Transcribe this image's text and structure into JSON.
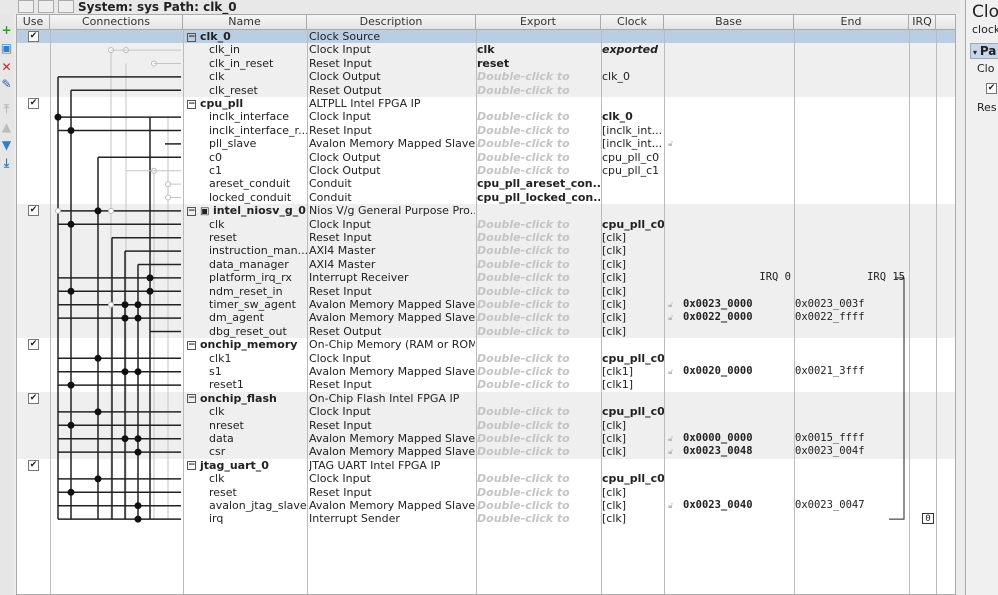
{
  "topbar": {
    "label": "System: sys   Path: clk_0"
  },
  "columns": {
    "use": "Use",
    "connections": "Connections",
    "name": "Name",
    "description": "Description",
    "export": "Export",
    "clock": "Clock",
    "base": "Base",
    "end": "End",
    "irq": "IRQ"
  },
  "toolbar": [
    {
      "icon": "add-icon",
      "glyph": "+",
      "color": "#2a9d2a"
    },
    {
      "icon": "add-connection-icon",
      "glyph": "▣",
      "color": "#2f7fc9"
    },
    {
      "icon": "remove-icon",
      "glyph": "✕",
      "color": "#d32020"
    },
    {
      "icon": "edit-icon",
      "glyph": "✎",
      "color": "#2f5fb0"
    },
    {
      "icon": "move-top-icon",
      "glyph": "⤒",
      "color": "#bbb"
    },
    {
      "icon": "move-up-icon",
      "glyph": "▲",
      "color": "#bbb"
    },
    {
      "icon": "move-down-icon",
      "glyph": "▼",
      "color": "#2f7fc9"
    },
    {
      "icon": "move-bottom-icon",
      "glyph": "⤓",
      "color": "#2f7fc9"
    }
  ],
  "rows": [
    {
      "type": "module",
      "name": "clk_0",
      "desc": "Clock Source",
      "export": "",
      "clock": "",
      "base": "",
      "end": "",
      "irq": "",
      "checked": true,
      "selected": true
    },
    {
      "name": "clk_in",
      "desc": "Clock Input",
      "export": "clk",
      "exportBold": true,
      "clock": "exported",
      "clockStyle": "bi"
    },
    {
      "name": "clk_in_reset",
      "desc": "Reset Input",
      "export": "reset",
      "exportBold": true,
      "clock": ""
    },
    {
      "name": "clk",
      "desc": "Clock Output",
      "export": "Double-click to",
      "clock": "clk_0"
    },
    {
      "name": "clk_reset",
      "desc": "Reset Output",
      "export": "Double-click to",
      "clock": ""
    },
    {
      "type": "module",
      "name": "cpu_pll",
      "desc": "ALTPLL Intel FPGA IP",
      "checked": true
    },
    {
      "name": "inclk_interface",
      "desc": "Clock Input",
      "export": "Double-click to",
      "clock": "clk_0",
      "clockStyle": "bold"
    },
    {
      "name": "inclk_interface_r...",
      "desc": "Reset Input",
      "export": "Double-click to",
      "clock": "[inclk_int..."
    },
    {
      "name": "pll_slave",
      "desc": "Avalon Memory Mapped Slave",
      "export": "Double-click to",
      "clock": "[inclk_int...",
      "lock": true
    },
    {
      "name": "c0",
      "desc": "Clock Output",
      "export": "Double-click to",
      "clock": "cpu_pll_c0"
    },
    {
      "name": "c1",
      "desc": "Clock Output",
      "export": "Double-click to",
      "clock": "cpu_pll_c1"
    },
    {
      "name": "areset_conduit",
      "desc": "Conduit",
      "export": "cpu_pll_areset_con...",
      "exportBold": true
    },
    {
      "name": "locked_conduit",
      "desc": "Conduit",
      "export": "cpu_pll_locked_con...",
      "exportBold": true
    },
    {
      "type": "module",
      "name": "intel_niosv_g_0",
      "desc": "Nios V/g General Purpose Pro...",
      "checked": true,
      "cpu": true
    },
    {
      "name": "clk",
      "desc": "Clock Input",
      "export": "Double-click to",
      "clock": "cpu_pll_c0",
      "clockStyle": "bold"
    },
    {
      "name": "reset",
      "desc": "Reset Input",
      "export": "Double-click to",
      "clock": "[clk]"
    },
    {
      "name": "instruction_man...",
      "desc": "AXI4 Master",
      "export": "Double-click to",
      "clock": "[clk]"
    },
    {
      "name": "data_manager",
      "desc": "AXI4 Master",
      "export": "Double-click to",
      "clock": "[clk]"
    },
    {
      "name": "platform_irq_rx",
      "desc": "Interrupt Receiver",
      "export": "Double-click to",
      "clock": "[clk]",
      "base": "IRQ 0",
      "end": "IRQ 15",
      "irqRange": true
    },
    {
      "name": "ndm_reset_in",
      "desc": "Reset Input",
      "export": "Double-click to",
      "clock": "[clk]"
    },
    {
      "name": "timer_sw_agent",
      "desc": "Avalon Memory Mapped Slave",
      "export": "Double-click to",
      "clock": "[clk]",
      "base": "0x0023_0000",
      "end": "0x0023_003f",
      "lock": true
    },
    {
      "name": "dm_agent",
      "desc": "Avalon Memory Mapped Slave",
      "export": "Double-click to",
      "clock": "[clk]",
      "base": "0x0022_0000",
      "end": "0x0022_ffff",
      "lock": true
    },
    {
      "name": "dbg_reset_out",
      "desc": "Reset Output",
      "export": "Double-click to",
      "clock": "[clk]"
    },
    {
      "type": "module",
      "name": "onchip_memory",
      "desc": "On-Chip Memory (RAM or ROM...",
      "checked": true
    },
    {
      "name": "clk1",
      "desc": "Clock Input",
      "export": "Double-click to",
      "clock": "cpu_pll_c0",
      "clockStyle": "bold"
    },
    {
      "name": "s1",
      "desc": "Avalon Memory Mapped Slave",
      "export": "Double-click to",
      "clock": "[clk1]",
      "base": "0x0020_0000",
      "end": "0x0021_3fff",
      "lock": true
    },
    {
      "name": "reset1",
      "desc": "Reset Input",
      "export": "Double-click to",
      "clock": "[clk1]"
    },
    {
      "type": "module",
      "name": "onchip_flash",
      "desc": "On-Chip Flash Intel FPGA IP",
      "checked": true
    },
    {
      "name": "clk",
      "desc": "Clock Input",
      "export": "Double-click to",
      "clock": "cpu_pll_c0",
      "clockStyle": "bold"
    },
    {
      "name": "nreset",
      "desc": "Reset Input",
      "export": "Double-click to",
      "clock": "[clk]"
    },
    {
      "name": "data",
      "desc": "Avalon Memory Mapped Slave",
      "export": "Double-click to",
      "clock": "[clk]",
      "base": "0x0000_0000",
      "end": "0x0015_ffff",
      "lock": true
    },
    {
      "name": "csr",
      "desc": "Avalon Memory Mapped Slave",
      "export": "Double-click to",
      "clock": "[clk]",
      "base": "0x0023_0048",
      "end": "0x0023_004f",
      "lock": true
    },
    {
      "type": "module",
      "name": "jtag_uart_0",
      "desc": "JTAG UART Intel FPGA IP",
      "checked": true
    },
    {
      "name": "clk",
      "desc": "Clock Input",
      "export": "Double-click to",
      "clock": "cpu_pll_c0",
      "clockStyle": "bold"
    },
    {
      "name": "reset",
      "desc": "Reset Input",
      "export": "Double-click to",
      "clock": "[clk]"
    },
    {
      "name": "avalon_jtag_slave",
      "desc": "Avalon Memory Mapped Slave",
      "export": "Double-click to",
      "clock": "[clk]",
      "base": "0x0023_0040",
      "end": "0x0023_0047",
      "lock": true
    },
    {
      "name": "irq",
      "desc": "Interrupt Sender",
      "export": "Double-click to",
      "clock": "[clk]",
      "irq": "0"
    }
  ],
  "right_panel": {
    "title": "Cloc",
    "subtitle": "clock",
    "section": "Pa",
    "line1": "Clo",
    "line2": "Res"
  }
}
